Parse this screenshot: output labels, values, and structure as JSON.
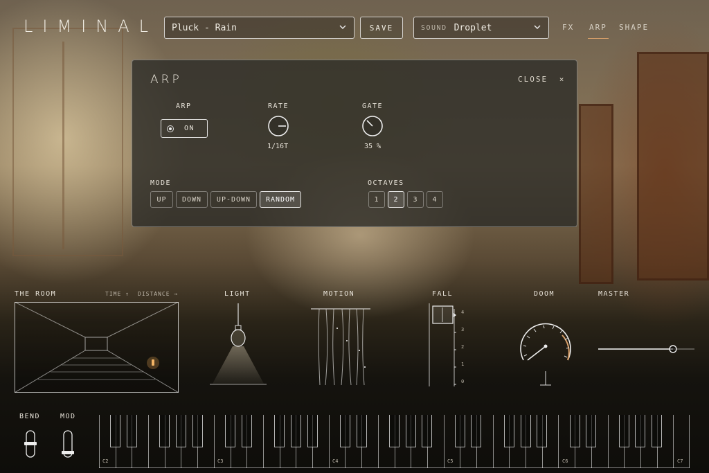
{
  "app": {
    "logo": "LIMINAL"
  },
  "header": {
    "preset": "Pluck - Rain",
    "save_label": "SAVE",
    "sound_label": "SOUND",
    "sound_value": "Droplet",
    "nav": [
      {
        "label": "FX",
        "active": false
      },
      {
        "label": "ARP",
        "active": true
      },
      {
        "label": "SHAPE",
        "active": false
      }
    ]
  },
  "arp_panel": {
    "title": "ARP",
    "close_label": "CLOSE",
    "arp_label": "ARP",
    "arp_toggle": "ON",
    "rate_label": "RATE",
    "rate_value": "1/16T",
    "gate_label": "GATE",
    "gate_value": "35 %",
    "mode_label": "MODE",
    "modes": [
      "UP",
      "DOWN",
      "UP-DOWN",
      "RANDOM"
    ],
    "mode_selected": "RANDOM",
    "octaves_label": "OCTAVES",
    "octaves": [
      "1",
      "2",
      "3",
      "4"
    ],
    "octave_selected": "2"
  },
  "room": {
    "label": "THE ROOM",
    "time_label": "TIME ↑",
    "distance_label": "DISTANCE →"
  },
  "light": {
    "label": "LIGHT"
  },
  "motion": {
    "label": "MOTION"
  },
  "fall": {
    "label": "FALL",
    "scale": [
      "4",
      "3",
      "2",
      "1",
      "0"
    ]
  },
  "doom": {
    "label": "DOOM"
  },
  "master": {
    "label": "MASTER",
    "level": 0.78
  },
  "wheels": {
    "bend_label": "BEND",
    "mod_label": "MOD"
  },
  "keyboard": {
    "octave_labels": [
      "C2",
      "C3",
      "C4",
      "C5",
      "C6",
      "C7"
    ]
  },
  "colors": {
    "accent": "#d9a06a",
    "panel": "#2a2a26",
    "text": "#e9e4da"
  }
}
